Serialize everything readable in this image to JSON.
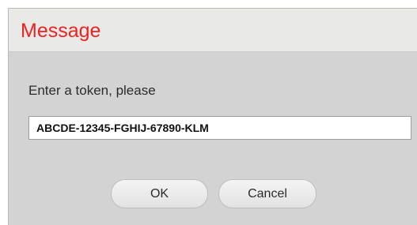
{
  "dialog": {
    "title": "Message",
    "title_color": "#ee2222",
    "prompt": "Enter a token, please",
    "token_value": "ABCDE-12345-FGHIJ-67890-KLM",
    "ok_label": "OK",
    "cancel_label": "Cancel"
  }
}
